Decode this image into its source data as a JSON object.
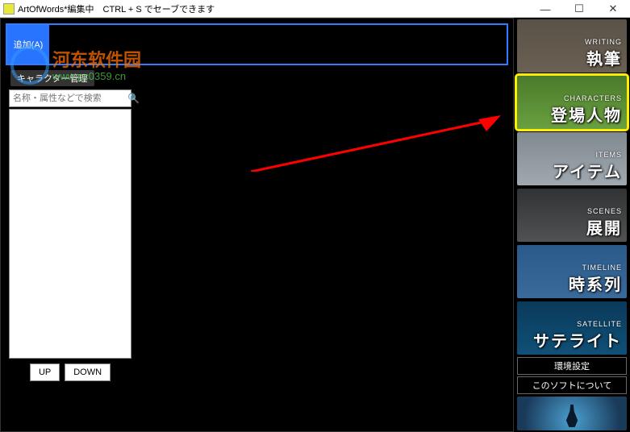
{
  "title": "ArtOfWords*編集中　CTRL + S でセーブできます",
  "window": {
    "min": "—",
    "max": "☐",
    "close": "✕"
  },
  "watermark": {
    "line1": "河东软件园",
    "line2": "www.pc0359.cn"
  },
  "top": {
    "add": "追加(A)"
  },
  "section": {
    "label": "キャラクター管理"
  },
  "search": {
    "placeholder": "名称・属性などで検索"
  },
  "buttons": {
    "up": "UP",
    "down": "DOWN"
  },
  "rail": {
    "writing": {
      "en": "WRITING",
      "jp": "執筆"
    },
    "characters": {
      "en": "CHARACTERS",
      "jp": "登場人物"
    },
    "items": {
      "en": "ITEMS",
      "jp": "アイテム"
    },
    "scenes": {
      "en": "SCENES",
      "jp": "展開"
    },
    "timeline": {
      "en": "TIMELINE",
      "jp": "時系列"
    },
    "satellite": {
      "en": "SATELLITE",
      "jp": "サテライト"
    }
  },
  "links": {
    "env": "環境設定",
    "about": "このソフトについて"
  }
}
